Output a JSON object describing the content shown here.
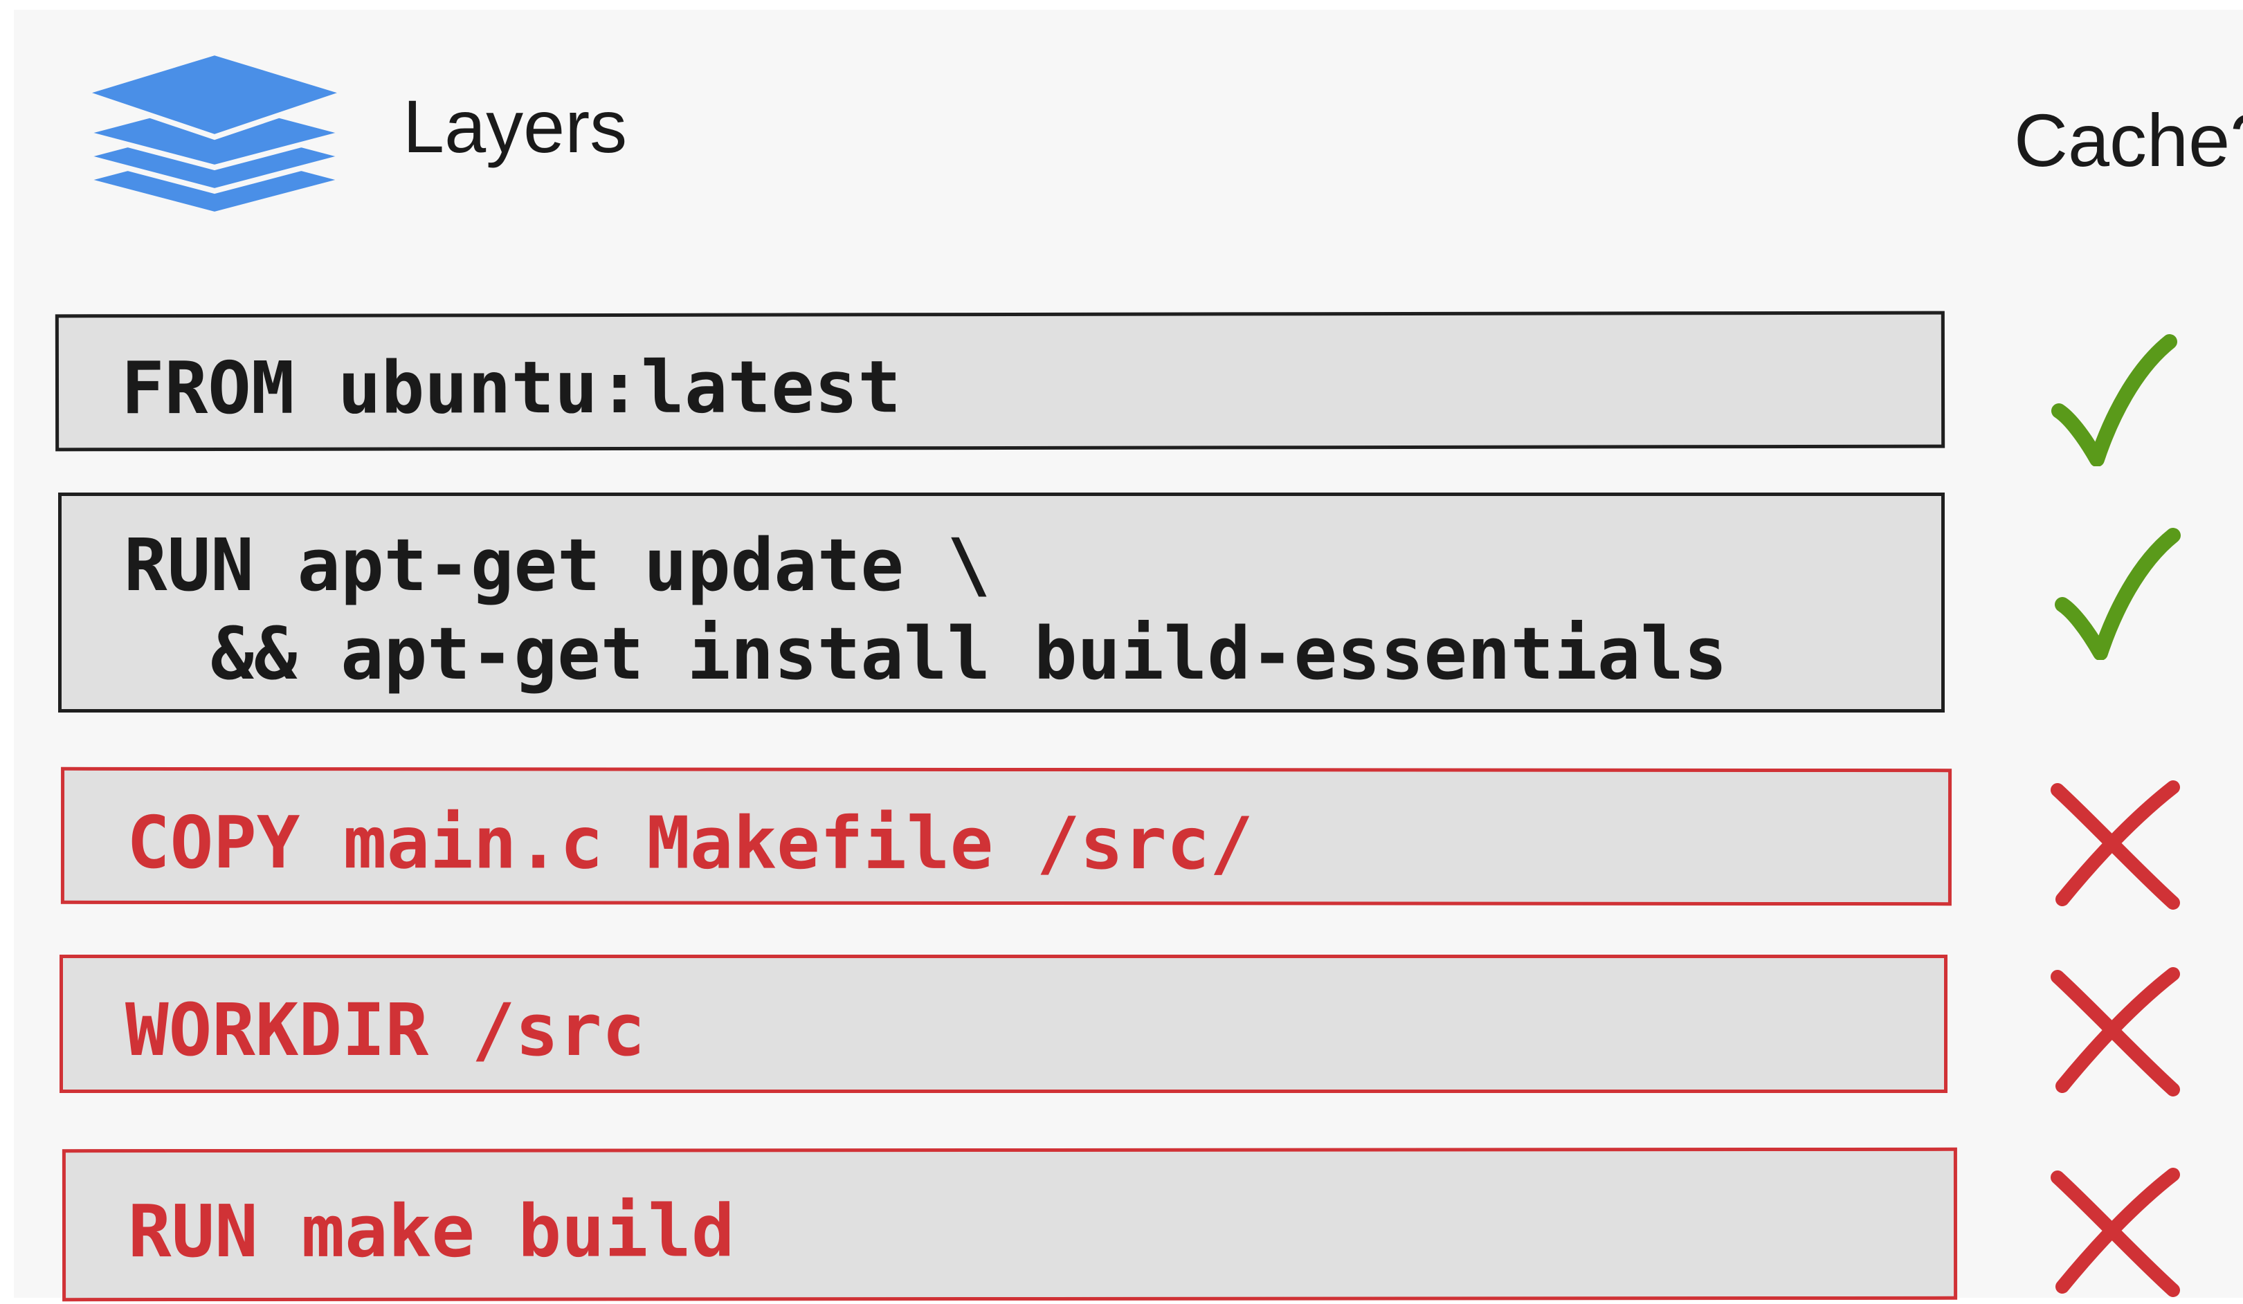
{
  "headings": {
    "layers": "Layers",
    "cache": "Cache?"
  },
  "colors": {
    "layer_icon": "#4a8fe7",
    "cached": "#1a1a1a",
    "invalidated": "#d03236",
    "check": "#5a9a1a",
    "box_fill": "#e0e0e0"
  },
  "rows": [
    {
      "lines": [
        "FROM ubuntu:latest"
      ],
      "cached": true,
      "icon": "check-icon"
    },
    {
      "lines": [
        "RUN apt-get update \\",
        "  && apt-get install build-essentials"
      ],
      "cached": true,
      "icon": "check-icon"
    },
    {
      "lines": [
        "COPY main.c Makefile /src/"
      ],
      "cached": false,
      "icon": "cross-icon"
    },
    {
      "lines": [
        "WORKDIR /src"
      ],
      "cached": false,
      "icon": "cross-icon"
    },
    {
      "lines": [
        "RUN make build"
      ],
      "cached": false,
      "icon": "cross-icon"
    }
  ]
}
